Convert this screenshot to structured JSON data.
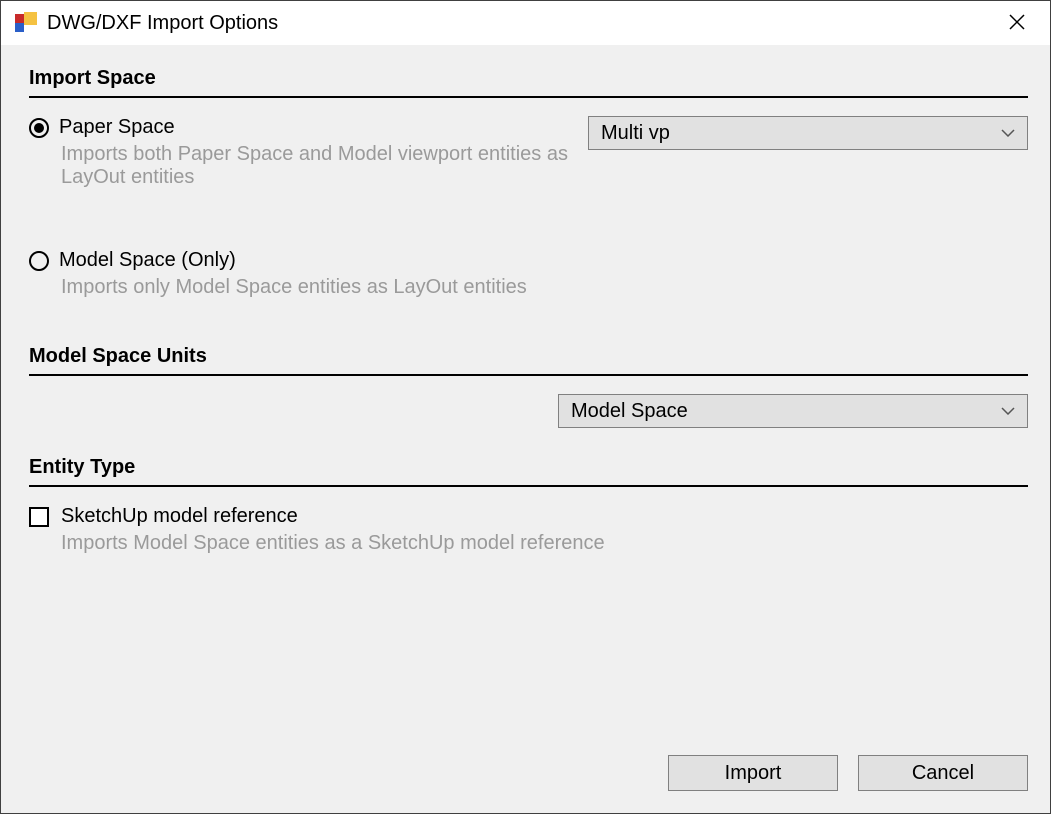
{
  "window": {
    "title": "DWG/DXF Import Options"
  },
  "sections": {
    "importSpace": {
      "header": "Import Space",
      "paperSpace": {
        "label": "Paper Space",
        "description": "Imports both Paper Space and Model viewport entities as LayOut entities",
        "selected": true
      },
      "viewportSelect": {
        "value": "Multi vp"
      },
      "modelSpace": {
        "label": "Model Space (Only)",
        "description": "Imports only Model Space entities as LayOut entities",
        "selected": false
      }
    },
    "modelSpaceUnits": {
      "header": "Model Space Units",
      "select": {
        "value": "Model Space"
      }
    },
    "entityType": {
      "header": "Entity Type",
      "checkbox": {
        "label": "SketchUp model reference",
        "description": "Imports Model Space entities as a SketchUp model reference",
        "checked": false
      }
    }
  },
  "buttons": {
    "import": "Import",
    "cancel": "Cancel"
  }
}
